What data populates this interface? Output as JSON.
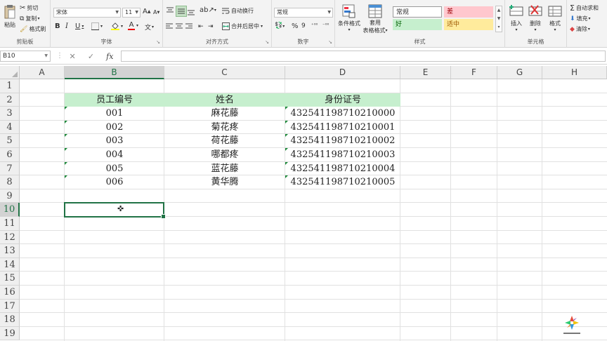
{
  "ribbon": {
    "clipboard": {
      "paste": "粘贴",
      "cut": "剪切",
      "copy": "复制",
      "format_painter": "格式刷",
      "label": "剪贴板"
    },
    "font": {
      "name": "宋体",
      "size": "11",
      "grow": "A",
      "shrink": "A",
      "bold": "B",
      "italic": "I",
      "underline": "U",
      "wen": "文",
      "label": "字体"
    },
    "alignment": {
      "wrap": "自动换行",
      "merge": "合并后居中",
      "label": "对齐方式"
    },
    "number": {
      "format": "常规",
      "percent": "%",
      "comma": "9",
      "label": "数字"
    },
    "styles": {
      "conditional": "条件格式",
      "table_line1": "套用",
      "table_line2": "表格格式",
      "normal": "常规",
      "bad": "差",
      "good": "好",
      "neutral": "适中",
      "label": "样式"
    },
    "cells": {
      "insert": "插入",
      "delete": "删除",
      "format": "格式",
      "label": "单元格"
    },
    "editing": {
      "autosum": "自动求和",
      "fill": "填充",
      "clear": "清除"
    }
  },
  "formula_bar": {
    "name_box": "B10",
    "fx": "fx",
    "value": ""
  },
  "grid": {
    "columns": [
      "A",
      "B",
      "C",
      "D",
      "E",
      "F",
      "G",
      "H"
    ],
    "rows": [
      "1",
      "2",
      "3",
      "4",
      "5",
      "6",
      "7",
      "8",
      "9",
      "10",
      "11",
      "12",
      "13",
      "14",
      "15",
      "16",
      "17",
      "18",
      "19"
    ],
    "selected_cell": "B10",
    "table": {
      "headers": [
        "员工编号",
        "姓名",
        "身份证号"
      ],
      "rows": [
        [
          "001",
          "麻花藤",
          "432541198710210000"
        ],
        [
          "002",
          "菊花疼",
          "432541198710210001"
        ],
        [
          "003",
          "荷花藤",
          "432541198710210002"
        ],
        [
          "004",
          "哪都疼",
          "432541198710210003"
        ],
        [
          "005",
          "蓝花藤",
          "432541198710210004"
        ],
        [
          "006",
          "黄华腾",
          "432541198710210005"
        ]
      ]
    }
  },
  "colors": {
    "accent": "#217346",
    "header_fill": "#c6efce",
    "error_triangle": "#1e8a3b"
  }
}
